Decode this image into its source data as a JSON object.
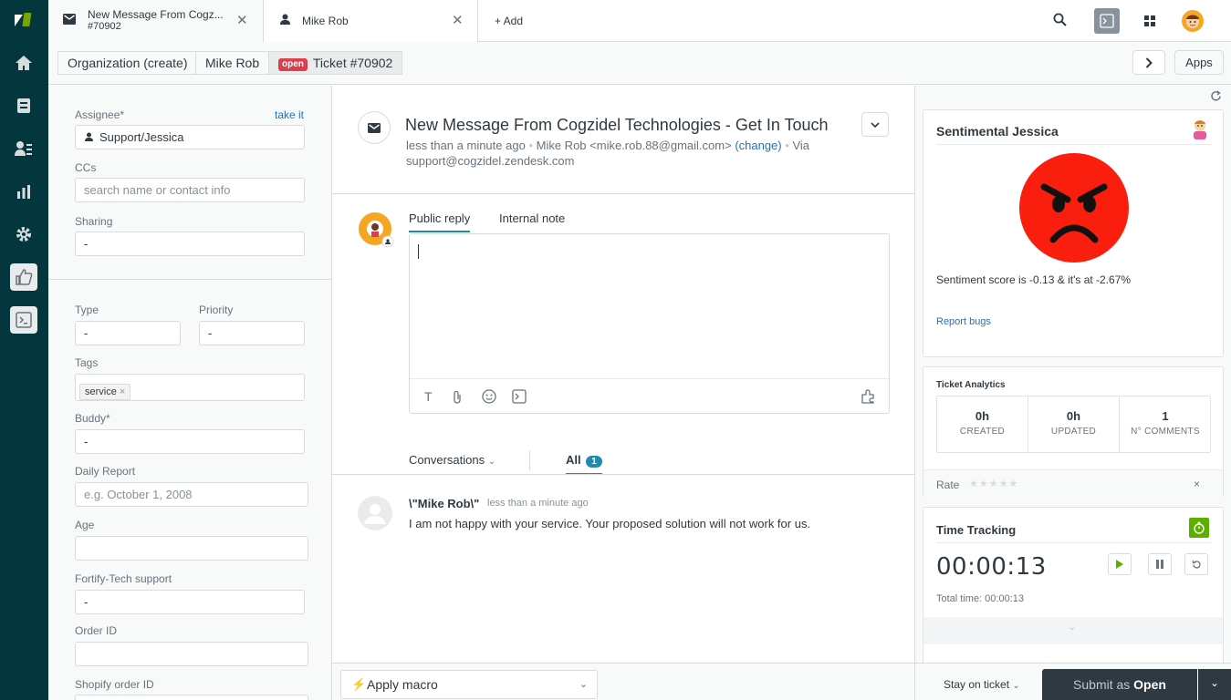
{
  "tabs": [
    {
      "title": "New Message From Cogz...",
      "subtitle": "#70902"
    },
    {
      "title": "Mike Rob"
    }
  ],
  "add_tab_label": "+ Add",
  "breadcrumbs": {
    "organization": "Organization (create)",
    "user": "Mike Rob",
    "status_badge": "open",
    "ticket": "Ticket #70902"
  },
  "apps_label": "Apps",
  "properties": {
    "assignee_label": "Assignee*",
    "take_it": "take it",
    "assignee_value": "Support/Jessica",
    "ccs_label": "CCs",
    "ccs_placeholder": "search name or contact info",
    "sharing_label": "Sharing",
    "sharing_value": "-",
    "type_label": "Type",
    "type_value": "-",
    "priority_label": "Priority",
    "priority_value": "-",
    "tags_label": "Tags",
    "tag": "service",
    "buddy_label": "Buddy*",
    "buddy_value": "-",
    "daily_report_label": "Daily Report",
    "daily_report_placeholder": "e.g. October 1, 2008",
    "age_label": "Age",
    "fortify_label": "Fortify-Tech support",
    "fortify_value": "-",
    "order_label": "Order ID",
    "shopify_label": "Shopify order ID"
  },
  "ticket": {
    "subject": "New Message From Cogzidel Technologies - Get In Touch",
    "time": "less than a minute ago",
    "requester": "Mike Rob <mike.rob.88@gmail.com>",
    "change": "(change)",
    "via": "Via",
    "via_address": "support@cogzidel.zendesk.com"
  },
  "composer": {
    "public_reply": "Public reply",
    "internal_note": "Internal note"
  },
  "filters": {
    "conversations": "Conversations",
    "all": "All",
    "all_count": "1"
  },
  "comment": {
    "author": "\\\"Mike Rob\\\"",
    "time": "less than a minute ago",
    "body": "I am not happy with your service. Your proposed solution will not work for us."
  },
  "footer": {
    "macro": "Apply macro",
    "stay": "Stay on ticket",
    "submit_prefix": "Submit as",
    "submit_status": "Open"
  },
  "sentiment": {
    "title": "Sentimental Jessica",
    "score_text": "Sentiment score is -0.13 & it's at -2.67%",
    "report": "Report bugs",
    "face_color": "#fa1e0e"
  },
  "analytics": {
    "title": "Ticket Analytics",
    "stats": [
      {
        "value": "0h",
        "label": "CREATED"
      },
      {
        "value": "0h",
        "label": "UPDATED"
      },
      {
        "value": "1",
        "label": "N° COMMENTS"
      }
    ],
    "rate_label": "Rate",
    "rating": 0
  },
  "time_tracking": {
    "title": "Time Tracking",
    "timer": "00:00:13",
    "total": "Total time: 00:00:13"
  },
  "colors": {
    "sidebar": "#03363d",
    "accent": "#1f73b7",
    "tab_active": "#1f8cae",
    "submit": "#2f3941",
    "timer_icon": "#5eae00"
  }
}
